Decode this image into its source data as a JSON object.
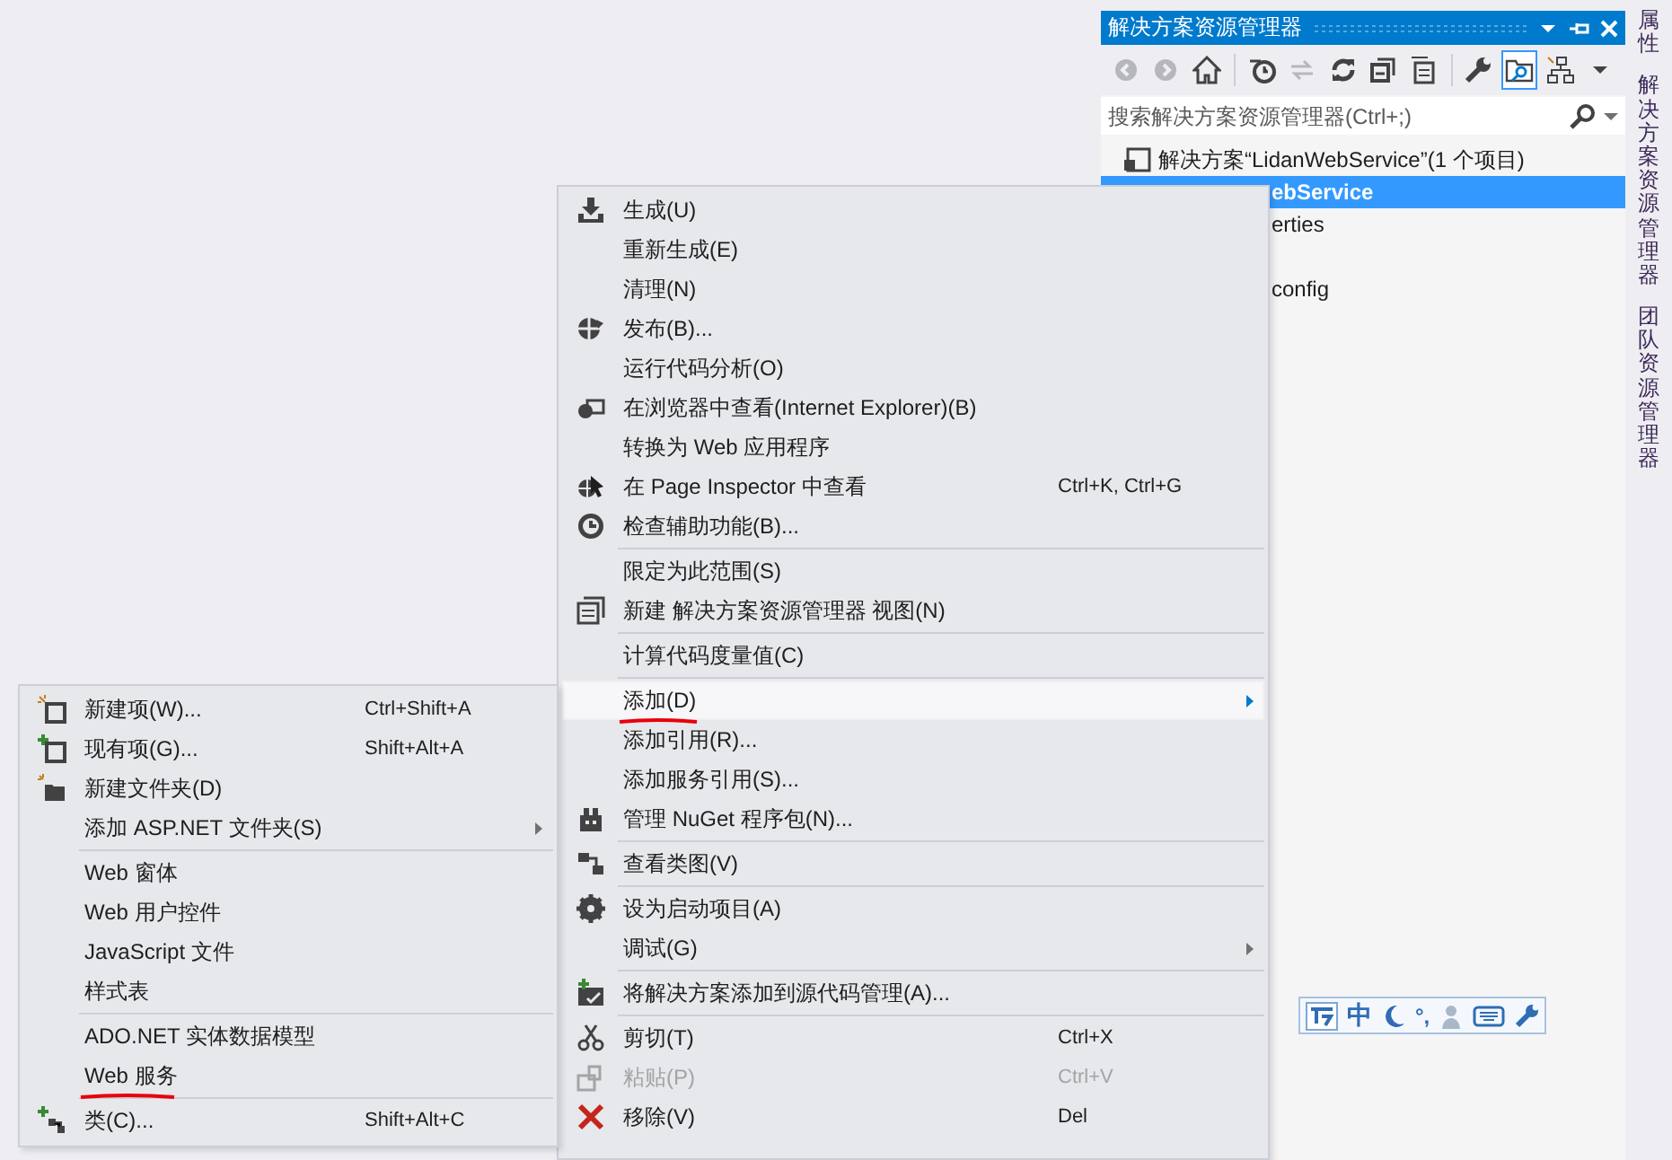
{
  "solution_explorer": {
    "title": "解决方案资源管理器",
    "toolbar": [
      {
        "selected": false,
        "disabled": true
      },
      {
        "selected": false,
        "disabled": true
      },
      {
        "selected": false,
        "disabled": false
      },
      {
        "selected": false,
        "disabled": false
      },
      {
        "selected": false,
        "disabled": true
      },
      {
        "selected": false,
        "disabled": false
      },
      {
        "selected": false,
        "disabled": false
      },
      {
        "selected": false,
        "disabled": false
      },
      {
        "selected": false,
        "disabled": false
      },
      {
        "selected": true,
        "disabled": false
      },
      {
        "selected": false,
        "disabled": false
      },
      {
        "selected": false,
        "disabled": false
      }
    ],
    "search": {
      "placeholder": "搜索解决方案资源管理器(Ctrl+;)"
    },
    "tree": [
      {
        "label": "解决方案“LidanWebService”(1 个项目)",
        "selected": false
      },
      {
        "label": "ebService",
        "selected": true
      },
      {
        "label": "erties",
        "selected": false
      },
      {
        "label": "config",
        "selected": false
      }
    ]
  },
  "side_tabs": [
    {
      "label": "属性"
    },
    {
      "label": "解决方案资源管理器"
    },
    {
      "label": "团队资源管理器"
    }
  ],
  "context_menu": {
    "items": [
      {
        "kind": "item",
        "label": "生成(U)",
        "selected": false,
        "disabled": false,
        "submenu": false,
        "underlined": false
      },
      {
        "kind": "item",
        "label": "重新生成(E)",
        "selected": false,
        "disabled": false,
        "submenu": false,
        "underlined": false
      },
      {
        "kind": "item",
        "label": "清理(N)",
        "selected": false,
        "disabled": false,
        "submenu": false,
        "underlined": false
      },
      {
        "kind": "item",
        "label": "发布(B)...",
        "selected": false,
        "disabled": false,
        "submenu": false,
        "underlined": false
      },
      {
        "kind": "item",
        "label": "运行代码分析(O)",
        "selected": false,
        "disabled": false,
        "submenu": false,
        "underlined": false
      },
      {
        "kind": "item",
        "label": "在浏览器中查看(Internet Explorer)(B)",
        "selected": false,
        "disabled": false,
        "submenu": false,
        "underlined": false
      },
      {
        "kind": "item",
        "label": "转换为 Web 应用程序",
        "selected": false,
        "disabled": false,
        "submenu": false,
        "underlined": false
      },
      {
        "kind": "item",
        "label": "在 Page Inspector 中查看",
        "shortcut": "Ctrl+K, Ctrl+G",
        "selected": false,
        "disabled": false,
        "submenu": false,
        "underlined": false
      },
      {
        "kind": "item",
        "label": "检查辅助功能(B)...",
        "selected": false,
        "disabled": false,
        "submenu": false,
        "underlined": false
      },
      {
        "kind": "separator"
      },
      {
        "kind": "item",
        "label": "限定为此范围(S)",
        "selected": false,
        "disabled": false,
        "submenu": false,
        "underlined": false
      },
      {
        "kind": "item",
        "label": "新建 解决方案资源管理器 视图(N)",
        "selected": false,
        "disabled": false,
        "submenu": false,
        "underlined": false
      },
      {
        "kind": "separator"
      },
      {
        "kind": "item",
        "label": "计算代码度量值(C)",
        "selected": false,
        "disabled": false,
        "submenu": false,
        "underlined": false
      },
      {
        "kind": "separator"
      },
      {
        "kind": "item",
        "label": "添加(D)",
        "selected": true,
        "disabled": false,
        "submenu": true,
        "underlined": true
      },
      {
        "kind": "item",
        "label": "添加引用(R)...",
        "selected": false,
        "disabled": false,
        "submenu": false,
        "underlined": false
      },
      {
        "kind": "item",
        "label": "添加服务引用(S)...",
        "selected": false,
        "disabled": false,
        "submenu": false,
        "underlined": false
      },
      {
        "kind": "item",
        "label": "管理 NuGet 程序包(N)...",
        "selected": false,
        "disabled": false,
        "submenu": false,
        "underlined": false
      },
      {
        "kind": "separator"
      },
      {
        "kind": "item",
        "label": "查看类图(V)",
        "selected": false,
        "disabled": false,
        "submenu": false,
        "underlined": false
      },
      {
        "kind": "separator"
      },
      {
        "kind": "item",
        "label": "设为启动项目(A)",
        "selected": false,
        "disabled": false,
        "submenu": false,
        "underlined": false
      },
      {
        "kind": "item",
        "label": "调试(G)",
        "selected": false,
        "disabled": false,
        "submenu": true,
        "underlined": false
      },
      {
        "kind": "separator"
      },
      {
        "kind": "item",
        "label": "将解决方案添加到源代码管理(A)...",
        "selected": false,
        "disabled": false,
        "submenu": false,
        "underlined": false
      },
      {
        "kind": "separator"
      },
      {
        "kind": "item",
        "label": "剪切(T)",
        "shortcut": "Ctrl+X",
        "selected": false,
        "disabled": false,
        "submenu": false,
        "underlined": false
      },
      {
        "kind": "item",
        "label": "粘贴(P)",
        "shortcut": "Ctrl+V",
        "selected": false,
        "disabled": true,
        "submenu": false,
        "underlined": false
      },
      {
        "kind": "item",
        "label": "移除(V)",
        "shortcut": "Del",
        "selected": false,
        "disabled": false,
        "submenu": false,
        "underlined": false
      }
    ]
  },
  "submenu": {
    "items": [
      {
        "kind": "item",
        "label": "新建项(W)...",
        "shortcut": "Ctrl+Shift+A",
        "selected": false,
        "disabled": false,
        "submenu": false,
        "underlined": false
      },
      {
        "kind": "item",
        "label": "现有项(G)...",
        "shortcut": "Shift+Alt+A",
        "selected": false,
        "disabled": false,
        "submenu": false,
        "underlined": false
      },
      {
        "kind": "item",
        "label": "新建文件夹(D)",
        "selected": false,
        "disabled": false,
        "submenu": false,
        "underlined": false
      },
      {
        "kind": "item",
        "label": "添加 ASP.NET 文件夹(S)",
        "selected": false,
        "disabled": false,
        "submenu": true,
        "underlined": false
      },
      {
        "kind": "separator"
      },
      {
        "kind": "item",
        "label": "Web 窗体",
        "selected": false,
        "disabled": false,
        "submenu": false,
        "underlined": false
      },
      {
        "kind": "item",
        "label": "Web 用户控件",
        "selected": false,
        "disabled": false,
        "submenu": false,
        "underlined": false
      },
      {
        "kind": "item",
        "label": "JavaScript 文件",
        "selected": false,
        "disabled": false,
        "submenu": false,
        "underlined": false
      },
      {
        "kind": "item",
        "label": "样式表",
        "selected": false,
        "disabled": false,
        "submenu": false,
        "underlined": false
      },
      {
        "kind": "separator"
      },
      {
        "kind": "item",
        "label": "ADO.NET 实体数据模型",
        "selected": false,
        "disabled": false,
        "submenu": false,
        "underlined": false
      },
      {
        "kind": "item",
        "label": "Web 服务",
        "selected": false,
        "disabled": false,
        "submenu": false,
        "underlined": true
      },
      {
        "kind": "separator"
      },
      {
        "kind": "item",
        "label": "类(C)...",
        "shortcut": "Shift+Alt+C",
        "selected": false,
        "disabled": false,
        "submenu": false,
        "underlined": false
      }
    ]
  },
  "ime_bar": {
    "language": "中",
    "punctuation": "°,"
  }
}
